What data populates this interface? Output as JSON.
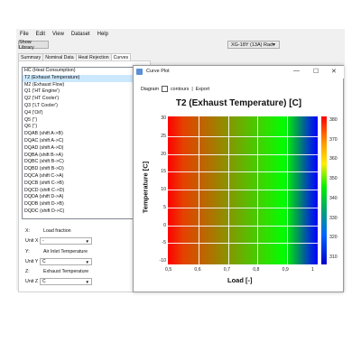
{
  "menu": [
    "File",
    "Edit",
    "View",
    "Dataset",
    "Help"
  ],
  "show_library": "Show Library",
  "model_select": "XG-18Y (13A) Rad",
  "tabs": [
    "Summary",
    "Nominal Data",
    "Heat Rejection",
    "Curves"
  ],
  "active_tab": "Curves",
  "list": [
    "HC (Heat Consumption)",
    "T2 (Exhaust Temperature)",
    "M2 (Exhaust Flow)",
    "Q1 ('HT Engine')",
    "Q2 ('HT Cooler')",
    "Q3 ('LT Cooler')",
    "Q4 ('Oil')",
    "Q5 ('')",
    "Q6 ('')",
    "DQAB (shift A->B)",
    "DQAC (shift A->C)",
    "DQAD (shift A->D)",
    "DQBA (shift B->A)",
    "DQBC (shift B->C)",
    "DQBD (shift B->D)",
    "DQCA (shift C->A)",
    "DQCB (shift C->B)",
    "DQCD (shift C->D)",
    "DQDA (shift D->A)",
    "DQDB (shift D->B)",
    "DQDC (shift D->C)"
  ],
  "selected_index": 1,
  "axes": {
    "x_label": "X:",
    "x_value": "Load fraction",
    "x_unit_label": "Unit X",
    "x_unit": "-",
    "y_label": "Y:",
    "y_value": "Air Inlet Temperature",
    "y_unit_label": "Unit Y",
    "y_unit": "C",
    "z_label": "Z:",
    "z_value": "Exhaust Temperature",
    "z_unit_label": "Unit Z",
    "z_unit": "C"
  },
  "plot_window": {
    "title": "Curve Plot",
    "diagram": "Diagram",
    "contours": "contours",
    "export": "Export",
    "minimize": "—",
    "maximize": "☐",
    "close": "✕"
  },
  "chart_data": {
    "type": "heatmap",
    "title": "T2 (Exhaust Temperature) [C]",
    "xlabel": "Load [-]",
    "ylabel": "Temperature [C]",
    "x_ticks": [
      "0,5",
      "0,6",
      "0,7",
      "0,8",
      "0,9",
      "1"
    ],
    "y_ticks": [
      "30",
      "25",
      "20",
      "15",
      "10",
      "5",
      "0",
      "-5",
      "-10"
    ],
    "colorbar_ticks": [
      "380",
      "370",
      "360",
      "350",
      "340",
      "330",
      "320",
      "310"
    ],
    "xlim": [
      0.5,
      1.0
    ],
    "ylim": [
      -10,
      30
    ],
    "zlim": [
      305,
      382
    ],
    "colors": {
      "high": "#ff0000",
      "mid": "#00ff00",
      "low": "#0000ff"
    }
  }
}
